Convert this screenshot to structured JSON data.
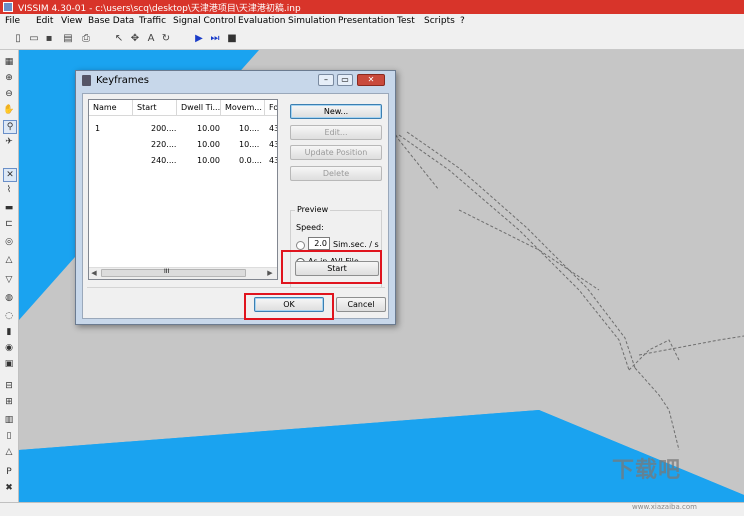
{
  "window": {
    "title": "VISSIM 4.30-01 - c:\\users\\scq\\desktop\\天津港项目\\天津港初稿.inp"
  },
  "menu": [
    "File",
    "Edit",
    "View",
    "Base Data",
    "Traffic",
    "Signal Control",
    "Evaluation",
    "Simulation",
    "Presentation",
    "Test",
    "Scripts",
    "?"
  ],
  "dialog": {
    "title": "Keyframes",
    "columns": [
      "Name",
      "Start",
      "Dwell Ti...",
      "Movem...",
      "Foc"
    ],
    "rows": [
      {
        "name": "1",
        "start": "200....",
        "dwell": "10.00",
        "movement": "10....",
        "focus": "43 ("
      },
      {
        "name": "",
        "start": "220....",
        "dwell": "10.00",
        "movement": "10....",
        "focus": "43 ("
      },
      {
        "name": "",
        "start": "240....",
        "dwell": "10.00",
        "movement": "0.0....",
        "focus": "43 ("
      }
    ],
    "scroll_grip": "III",
    "buttons": {
      "new": "New...",
      "edit": "Edit...",
      "update": "Update Position",
      "delete": "Delete",
      "start": "Start",
      "ok": "OK",
      "cancel": "Cancel"
    },
    "preview": {
      "label": "Preview",
      "speed_label": "Speed:",
      "speed_value": "2.0",
      "speed_unit": "Sim.sec. / s",
      "avi_option": "As in AVI File"
    }
  },
  "watermark": {
    "text": "下载吧",
    "url": "www.xiazaiba.com"
  },
  "colors": {
    "title_bar": "#d8342a",
    "canvas_bg": "#1aa3f0",
    "network_bg": "#c6c6c6",
    "highlight": "#e0141e"
  }
}
